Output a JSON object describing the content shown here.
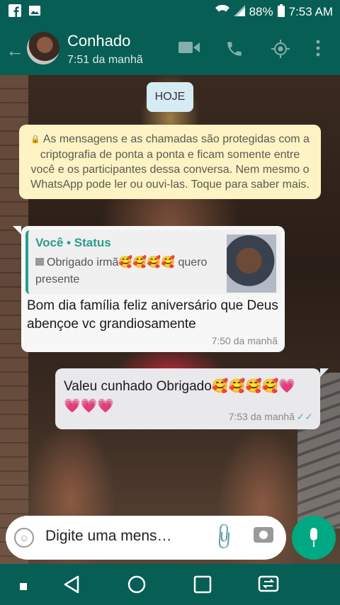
{
  "status_bar": {
    "battery": "88%",
    "time": "7:53 AM"
  },
  "header": {
    "contact_name": "Conhado",
    "last_seen": "7:51 da manhã"
  },
  "chat": {
    "date_chip": "HOJE",
    "encryption_notice": "As mensagens e as chamadas são protegidas com a criptografia de ponta a ponta e ficam somente entre você e os participantes dessa conversa. Nem mesmo o WhatsApp pode ler ou ouvi-las. Toque para saber mais.",
    "incoming": {
      "quote_author": "Você • Status",
      "quote_text": "Obrigado irmã🥰🥰🥰🥰 quero presente",
      "text": "Bom dia família feliz aniversário que Deus abençoe vc grandiosamente",
      "time": "7:50 da manhã"
    },
    "outgoing": {
      "text": "Valeu cunhado Obrigado🥰🥰🥰🥰💗💗💗💗",
      "time": "7:53 da manhã"
    }
  },
  "composer": {
    "placeholder": "Digite uma mens…"
  },
  "icons": {
    "accent": "#075e54",
    "send": "#00a884"
  }
}
